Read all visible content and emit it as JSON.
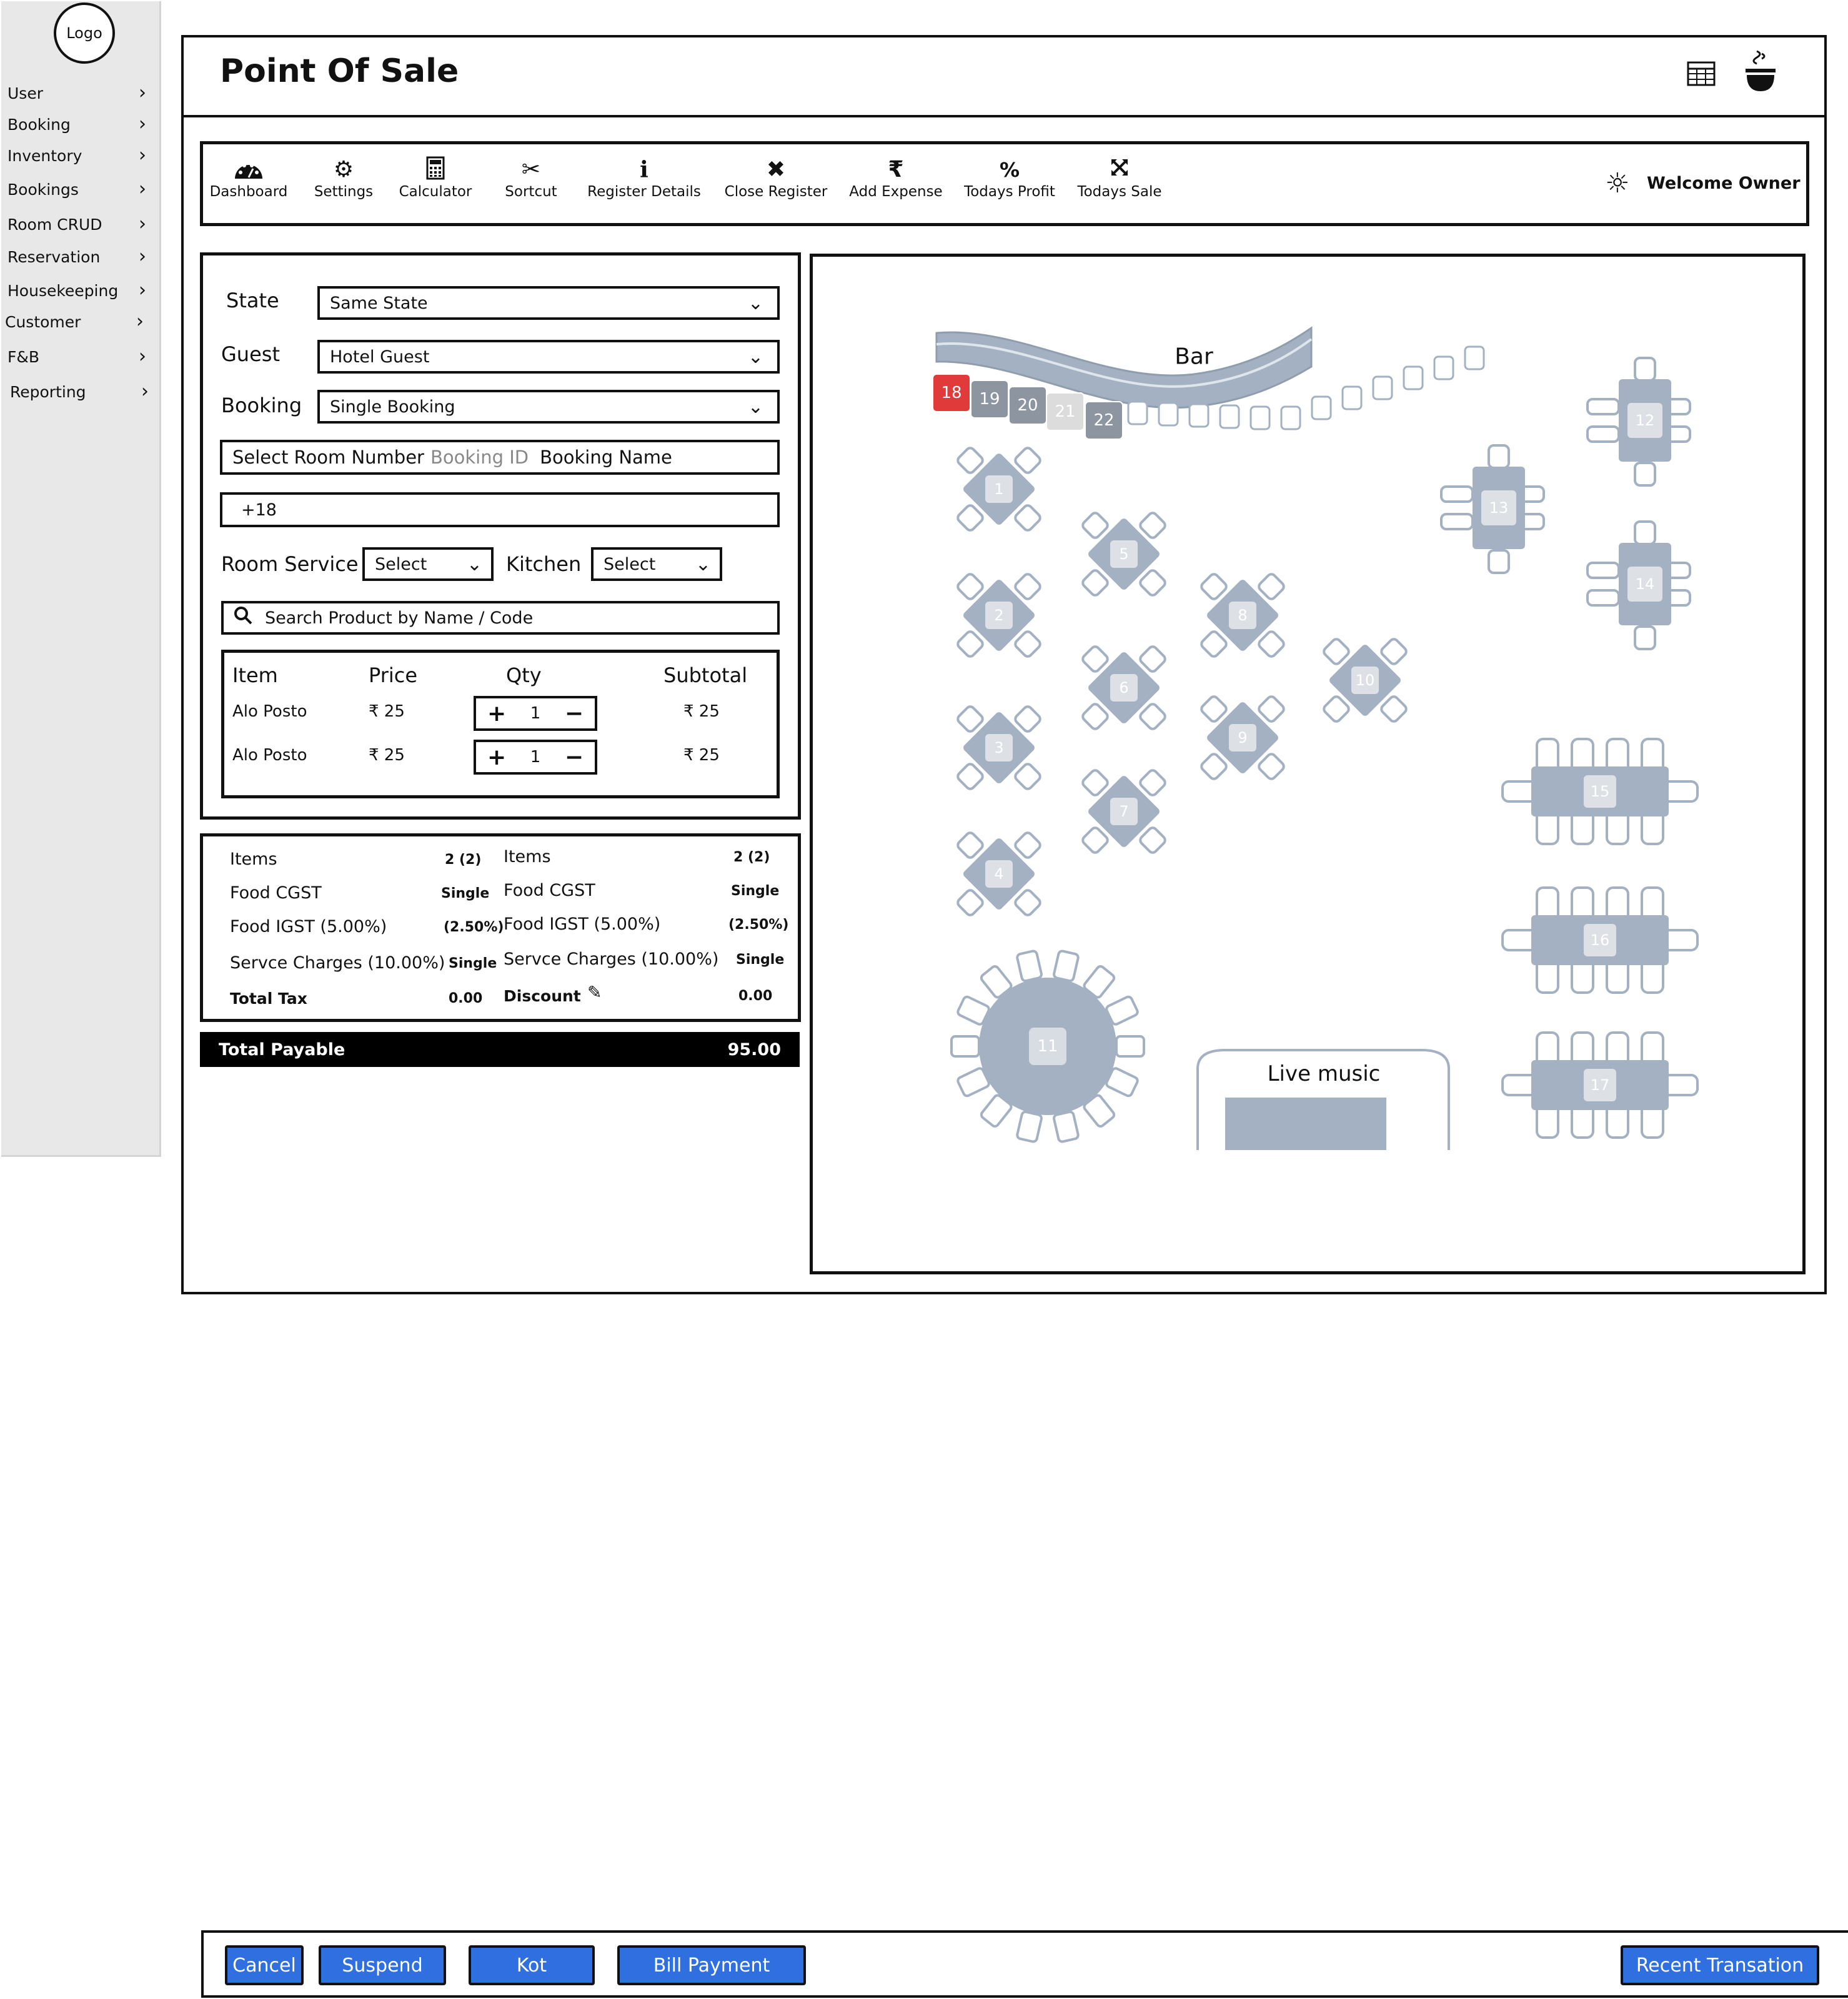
{
  "sidebar": {
    "logo": "Logo",
    "items": [
      {
        "label": "User"
      },
      {
        "label": "Booking"
      },
      {
        "label": "Inventory"
      },
      {
        "label": "Bookings"
      },
      {
        "label": "Room CRUD"
      },
      {
        "label": "Reservation"
      },
      {
        "label": "Housekeeping"
      },
      {
        "label": "Customer"
      },
      {
        "label": "F&B"
      },
      {
        "label": "Reporting"
      }
    ]
  },
  "header": {
    "title": "Point Of Sale",
    "icons": [
      "table-grid-icon",
      "food-bowl-icon"
    ]
  },
  "toolbar": {
    "items": [
      {
        "label": "Dashboard",
        "icon": "dashboard-icon"
      },
      {
        "label": "Settings",
        "icon": "gear-icon"
      },
      {
        "label": "Calculator",
        "icon": "calculator-icon"
      },
      {
        "label": "Sortcut",
        "icon": "scissors-icon"
      },
      {
        "label": "Register Details",
        "icon": "info-icon"
      },
      {
        "label": "Close Register",
        "icon": "close-icon"
      },
      {
        "label": "Add Expense",
        "icon": "rupee-icon"
      },
      {
        "label": "Todays Profit",
        "icon": "percent-icon"
      },
      {
        "label": "Todays Sale",
        "icon": "expand-icon"
      }
    ],
    "welcome": "Welcome Owner"
  },
  "form": {
    "state_label": "State",
    "state_value": "Same State",
    "guest_label": "Guest",
    "guest_value": "Hotel Guest",
    "booking_label": "Booking",
    "booking_value": "Single Booking",
    "room_select_a": "Select Room Number",
    "room_select_b": "Booking ID",
    "room_select_c": "Booking Name",
    "phone_value": "+18",
    "room_service_label": "Room Service",
    "room_service_value": "Select",
    "kitchen_label": "Kitchen",
    "kitchen_value": "Select",
    "search_placeholder": "Search Product by Name / Code"
  },
  "cart": {
    "headers": {
      "item": "Item",
      "price": "Price",
      "qty": "Qty",
      "subtotal": "Subtotal"
    },
    "rows": [
      {
        "item": "Alo Posto",
        "price": "₹ 25",
        "qty": "1",
        "subtotal": "₹ 25"
      },
      {
        "item": "Alo Posto",
        "price": "₹ 25",
        "qty": "1",
        "subtotal": "₹ 25"
      }
    ]
  },
  "summary": {
    "left": [
      {
        "label": "Items",
        "value": "2 (2)"
      },
      {
        "label": "Food CGST",
        "value": "Single"
      },
      {
        "label": "Food IGST (5.00%)",
        "value": "(2.50%)"
      },
      {
        "label": "Servce Charges (10.00%)",
        "value": "Single"
      },
      {
        "label": "Total Tax",
        "value": "0.00"
      }
    ],
    "right": [
      {
        "label": "Items",
        "value": "2 (2)"
      },
      {
        "label": "Food CGST",
        "value": "Single"
      },
      {
        "label": "Food IGST (5.00%)",
        "value": "(2.50%)"
      },
      {
        "label": "Servce Charges (10.00%)",
        "value": "Single"
      },
      {
        "label": "Discount",
        "value": "0.00"
      }
    ],
    "total_label": "Total Payable",
    "total_value": "95.00"
  },
  "floor": {
    "bar_label": "Bar",
    "live_music_label": "Live music",
    "bar_seats": [
      "18",
      "19",
      "20",
      "21",
      "22"
    ],
    "tables": [
      "1",
      "2",
      "3",
      "4",
      "5",
      "6",
      "7",
      "8",
      "9",
      "10",
      "11",
      "12",
      "13",
      "14",
      "15",
      "16",
      "17"
    ],
    "colors": {
      "table": "#a3b1c2",
      "occupied": "#e03a3a",
      "seat_dark": "#8c95a0",
      "seat_light": "#dcdcdc"
    }
  },
  "actions": {
    "cancel": "Cancel",
    "suspend": "Suspend",
    "kot": "Kot",
    "bill_payment": "Bill Payment",
    "recent": "Recent Transation"
  }
}
